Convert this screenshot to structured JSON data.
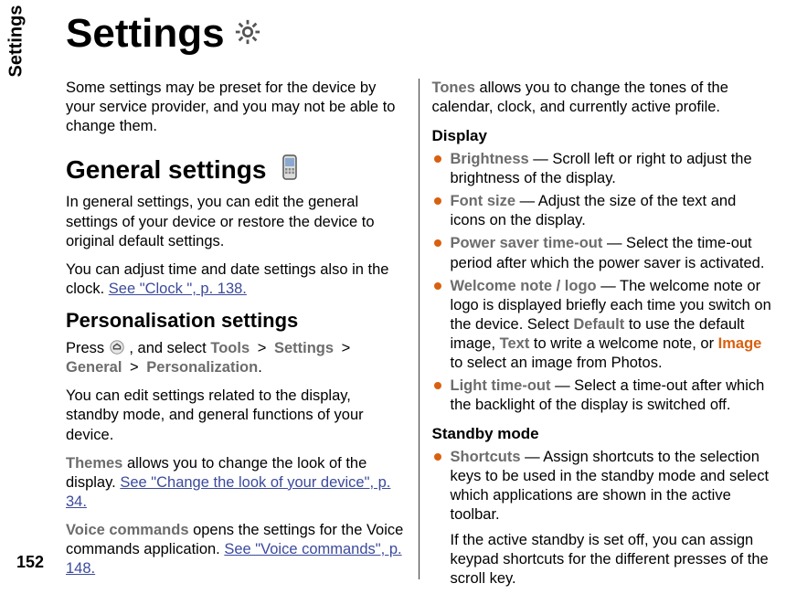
{
  "side_tab": "Settings",
  "page_number": "152",
  "title": "Settings",
  "intro": "Some settings may be preset for the device by your service provider, and you may not be able to change them.",
  "general": {
    "heading": "General settings",
    "p1": "In general settings, you can edit the general settings of your device or restore the device to original default settings.",
    "p2_a": "You can adjust time and date settings also in the clock. ",
    "p2_link": "See \"Clock \", p. 138."
  },
  "personalisation": {
    "heading": "Personalisation settings",
    "press": "Press ",
    "and_select": ", and select ",
    "path": [
      "Tools",
      "Settings",
      "General",
      "Personalization"
    ],
    "p2": "You can edit settings related to the display, standby mode, and general functions of your device.",
    "themes_label": "Themes",
    "themes_text": " allows you to change the look of the display. ",
    "themes_link": "See \"Change the look of your device\", p. 34.",
    "voice_label": "Voice commands",
    "voice_text": " opens the settings for the Voice commands application. ",
    "voice_link": "See \"Voice commands\", p. 148.",
    "tones_label": "Tones",
    "tones_text": " allows you to change the tones of the calendar, clock, and currently active profile."
  },
  "display": {
    "heading": "Display",
    "items": [
      {
        "name": "Brightness",
        "text": " — Scroll left or right to adjust the brightness of the display."
      },
      {
        "name": "Font size",
        "text": " — Adjust the size of the text and icons on the display."
      },
      {
        "name": "Power saver time-out",
        "text": " — Select the time-out period after which the power saver is activated."
      },
      {
        "name": "Welcome note / logo",
        "text_a": " — The welcome note or logo is displayed briefly each time you switch on the device. Select ",
        "opt_default": "Default",
        "text_b": " to use the default image, ",
        "opt_text": "Text",
        "text_c": " to write a welcome note, or ",
        "opt_image": "Image",
        "text_d": " to select an image from Photos."
      },
      {
        "name": "Light time-out",
        "text": " — Select a time-out after which the backlight of the display is switched off."
      }
    ]
  },
  "standby": {
    "heading": "Standby mode",
    "items": [
      {
        "name": "Shortcuts",
        "text": " — Assign shortcuts to the selection keys to be used in the standby mode and select which applications are shown in the active toolbar."
      }
    ],
    "note": "If the active standby is set off, you can assign keypad shortcuts for the different presses of the scroll key."
  }
}
